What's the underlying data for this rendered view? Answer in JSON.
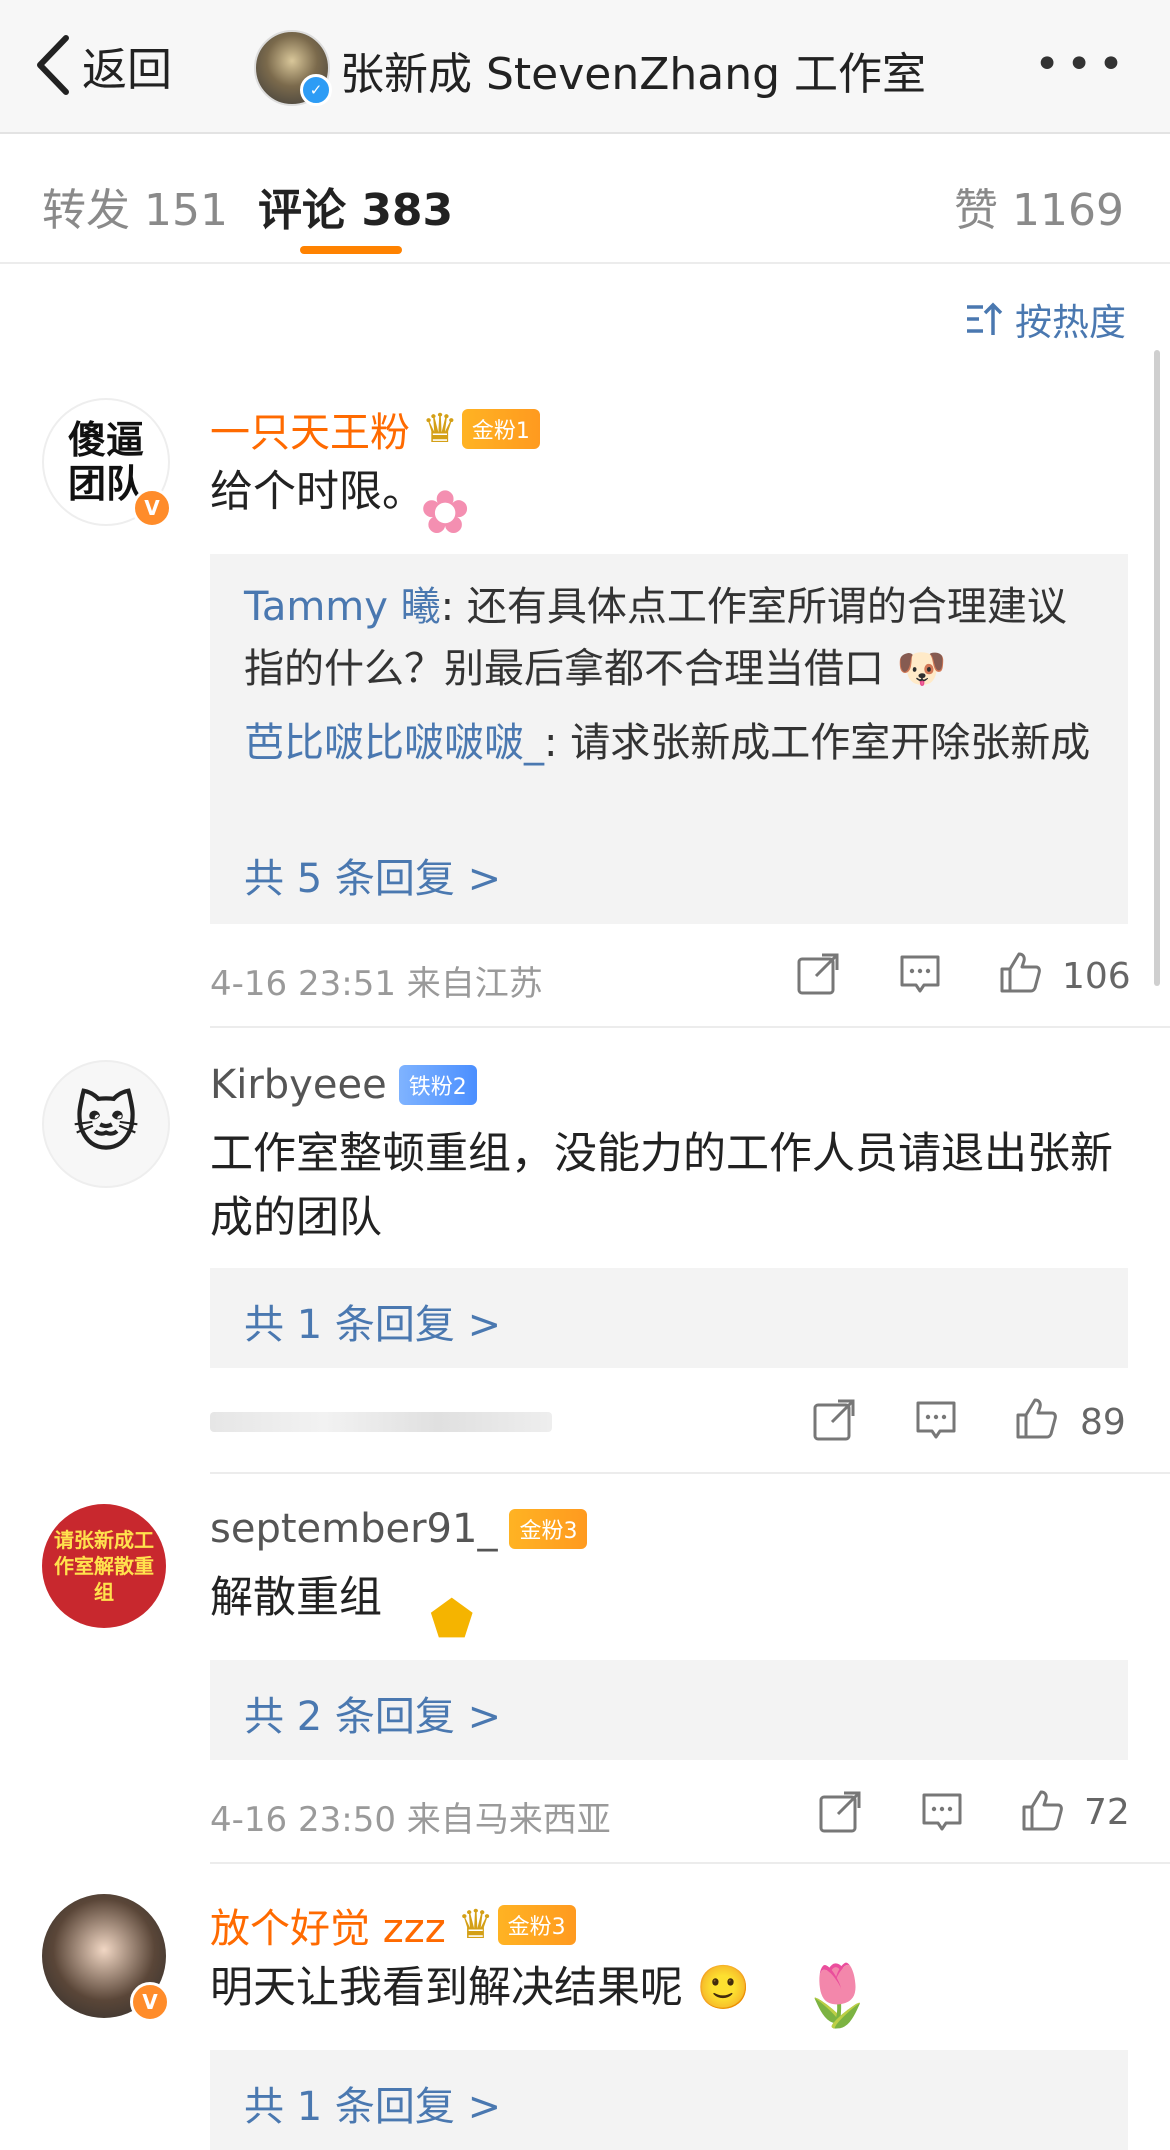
{
  "header": {
    "back_label": "返回",
    "account_name": "张新成 StevenZhang 工作室",
    "more_label": "•••"
  },
  "tabs": {
    "repost": "转发 151",
    "comment": "评论 383",
    "like": "赞 1169"
  },
  "sort": {
    "label": "按热度"
  },
  "comments": [
    {
      "username": "一只天王粉",
      "badge": "金粉1",
      "avatar_text": "傻逼团队",
      "text": "给个时限。",
      "replies": [
        {
          "user": "Tammy 曦",
          "text": ": 还有具体点工作室所谓的合理建议指的什么？别最后拿都不合理当借口"
        },
        {
          "user": "芭比啵比啵啵啵_",
          "text": ": 请求张新成工作室开除张新成"
        }
      ],
      "reply_more": "共 5 条回复 >",
      "time": "4-16 23:51 来自江苏",
      "likes": "106"
    },
    {
      "username": "Kirbyeee",
      "badge": "铁粉2",
      "text": "工作室整顿重组，没能力的工作人员请退出张新成的团队",
      "reply_more": "共 1 条回复 >",
      "likes": "89"
    },
    {
      "username": "september91_",
      "badge": "金粉3",
      "avatar_text": "请张新成工作室解散重组",
      "text": "解散重组",
      "reply_more": "共 2 条回复 >",
      "time": "4-16 23:50 来自马来西亚",
      "likes": "72"
    },
    {
      "username": "放个好觉 zzz",
      "badge": "金粉3",
      "text": "明天让我看到解决结果呢",
      "reply_more": "共 1 条回复 >"
    }
  ],
  "colors": {
    "orange_name": "#ff6a00",
    "link_blue": "#4a78b0",
    "tab_indicator": "#ff8200"
  }
}
